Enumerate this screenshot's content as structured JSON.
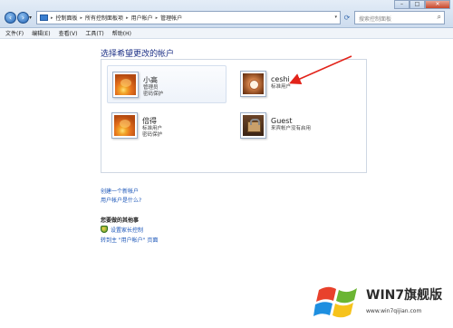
{
  "address_bar": {
    "breadcrumbs": [
      "控制面板",
      "所有控制面板项",
      "用户帐户",
      "管理帐户"
    ],
    "search_placeholder": "搜索控制面板"
  },
  "menu": {
    "items": [
      "文件(F)",
      "编辑(E)",
      "查看(V)",
      "工具(T)",
      "帮助(H)"
    ]
  },
  "content": {
    "heading": "选择希望更改的帐户",
    "accounts": [
      {
        "name": "小高",
        "lines": [
          "管理员",
          "密码保护"
        ],
        "picture": "flower-icon"
      },
      {
        "name": "ceshi",
        "lines": [
          "标准用户"
        ],
        "picture": "ceshi-avatar-icon"
      },
      {
        "name": "倍得",
        "lines": [
          "标准用户",
          "密码保护"
        ],
        "picture": "flower-icon"
      },
      {
        "name": "Guest",
        "lines": [
          "来宾帐户没有启用"
        ],
        "picture": "briefcase-icon"
      }
    ],
    "links": {
      "create_account": "创建一个新帐户",
      "what_is_account": "用户帐户是什么?"
    },
    "additional": {
      "title": "您要做的其他事",
      "parental_controls": "设置家长控制",
      "go_main": "转到主 \"用户帐户\" 页面"
    }
  },
  "annotation": {
    "arrow_color": "#e2231a"
  },
  "watermark": {
    "brand": "WIN7旗舰版",
    "url": "www.win7qijian.com"
  }
}
